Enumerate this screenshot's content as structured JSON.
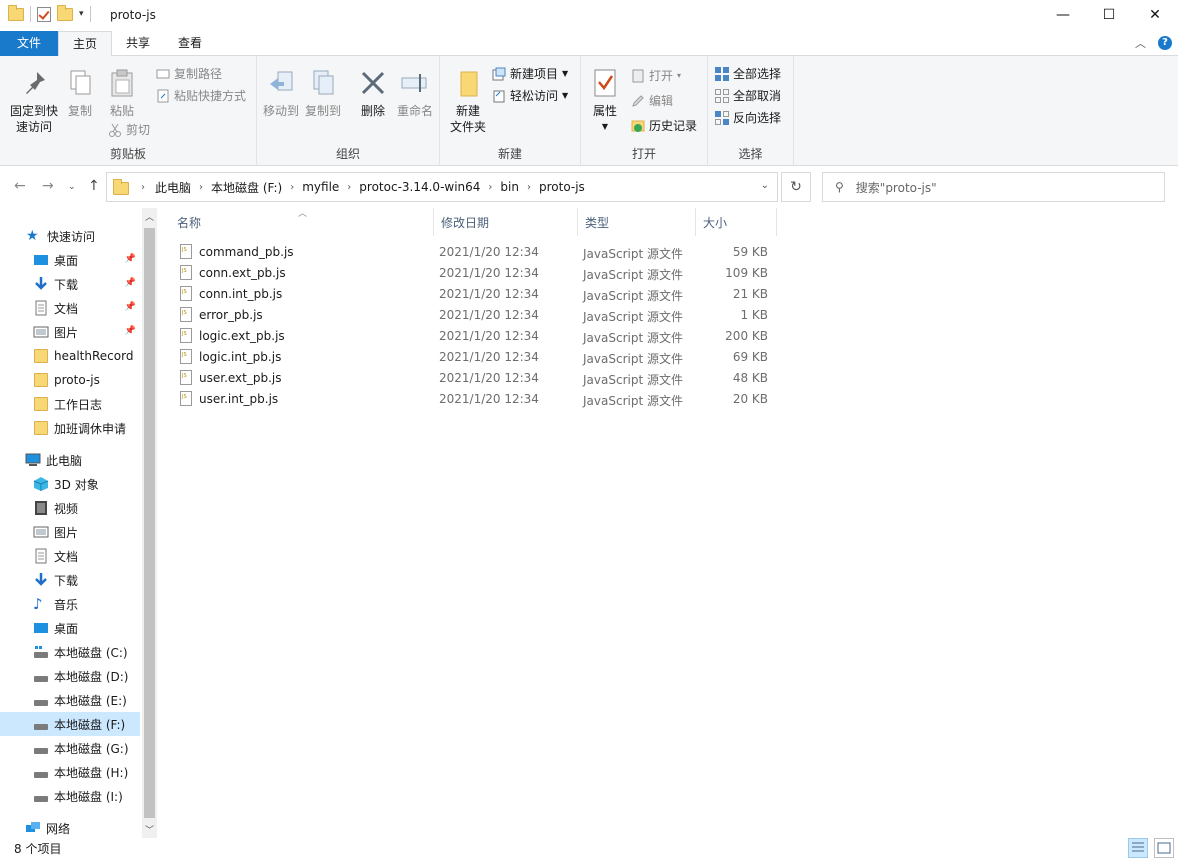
{
  "window": {
    "title": "proto-js",
    "minimize": "—",
    "maximize": "☐",
    "close": "✕"
  },
  "tabs": [
    {
      "label": "文件"
    },
    {
      "label": "主页"
    },
    {
      "label": "共享"
    },
    {
      "label": "查看"
    }
  ],
  "ribbon": {
    "clipboard": {
      "label": "剪贴板",
      "pin_quick": "固定到快速访问",
      "pin_quick_l1": "固定到快",
      "pin_quick_l2": "速访问",
      "copy": "复制",
      "paste": "粘贴",
      "copy_path": "复制路径",
      "paste_shortcut": "粘贴快捷方式",
      "cut": "剪切"
    },
    "organize": {
      "label": "组织",
      "move_to": "移动到",
      "copy_to": "复制到",
      "delete": "删除",
      "rename": "重命名"
    },
    "new": {
      "label": "新建",
      "new_folder_l1": "新建",
      "new_folder_l2": "文件夹",
      "new_item": "新建项目",
      "easy_access": "轻松访问"
    },
    "open": {
      "label": "打开",
      "properties": "属性",
      "open": "打开",
      "edit": "编辑",
      "history": "历史记录"
    },
    "select": {
      "label": "选择",
      "select_all": "全部选择",
      "select_none": "全部取消",
      "invert": "反向选择"
    }
  },
  "address": {
    "crumbs": [
      "此电脑",
      "本地磁盘 (F:)",
      "myfile",
      "protoc-3.14.0-win64",
      "bin",
      "proto-js"
    ],
    "search_placeholder": "搜索\"proto-js\""
  },
  "nav": {
    "quick_access": "快速访问",
    "quick_items": [
      {
        "label": "桌面",
        "pinned": true
      },
      {
        "label": "下载",
        "pinned": true
      },
      {
        "label": "文档",
        "pinned": true
      },
      {
        "label": "图片",
        "pinned": true
      },
      {
        "label": "healthRecord",
        "pinned": false
      },
      {
        "label": "proto-js",
        "pinned": false
      },
      {
        "label": "工作日志",
        "pinned": false
      },
      {
        "label": "加班调休申请",
        "pinned": false
      }
    ],
    "this_pc": "此电脑",
    "pc_items": [
      {
        "label": "3D 对象"
      },
      {
        "label": "视频"
      },
      {
        "label": "图片"
      },
      {
        "label": "文档"
      },
      {
        "label": "下载"
      },
      {
        "label": "音乐"
      },
      {
        "label": "桌面"
      },
      {
        "label": "本地磁盘 (C:)"
      },
      {
        "label": "本地磁盘 (D:)"
      },
      {
        "label": "本地磁盘 (E:)"
      },
      {
        "label": "本地磁盘 (F:)"
      },
      {
        "label": "本地磁盘 (G:)"
      },
      {
        "label": "本地磁盘 (H:)"
      },
      {
        "label": "本地磁盘 (I:)"
      }
    ],
    "network": "网络"
  },
  "columns": {
    "name": "名称",
    "date": "修改日期",
    "type": "类型",
    "size": "大小"
  },
  "files": [
    {
      "name": "command_pb.js",
      "date": "2021/1/20 12:34",
      "type": "JavaScript 源文件",
      "size": "59 KB"
    },
    {
      "name": "conn.ext_pb.js",
      "date": "2021/1/20 12:34",
      "type": "JavaScript 源文件",
      "size": "109 KB"
    },
    {
      "name": "conn.int_pb.js",
      "date": "2021/1/20 12:34",
      "type": "JavaScript 源文件",
      "size": "21 KB"
    },
    {
      "name": "error_pb.js",
      "date": "2021/1/20 12:34",
      "type": "JavaScript 源文件",
      "size": "1 KB"
    },
    {
      "name": "logic.ext_pb.js",
      "date": "2021/1/20 12:34",
      "type": "JavaScript 源文件",
      "size": "200 KB"
    },
    {
      "name": "logic.int_pb.js",
      "date": "2021/1/20 12:34",
      "type": "JavaScript 源文件",
      "size": "69 KB"
    },
    {
      "name": "user.ext_pb.js",
      "date": "2021/1/20 12:34",
      "type": "JavaScript 源文件",
      "size": "48 KB"
    },
    {
      "name": "user.int_pb.js",
      "date": "2021/1/20 12:34",
      "type": "JavaScript 源文件",
      "size": "20 KB"
    }
  ],
  "status": {
    "count": "8 个项目"
  },
  "colors": {
    "accent": "#1979ca",
    "selection": "#cce8ff"
  }
}
